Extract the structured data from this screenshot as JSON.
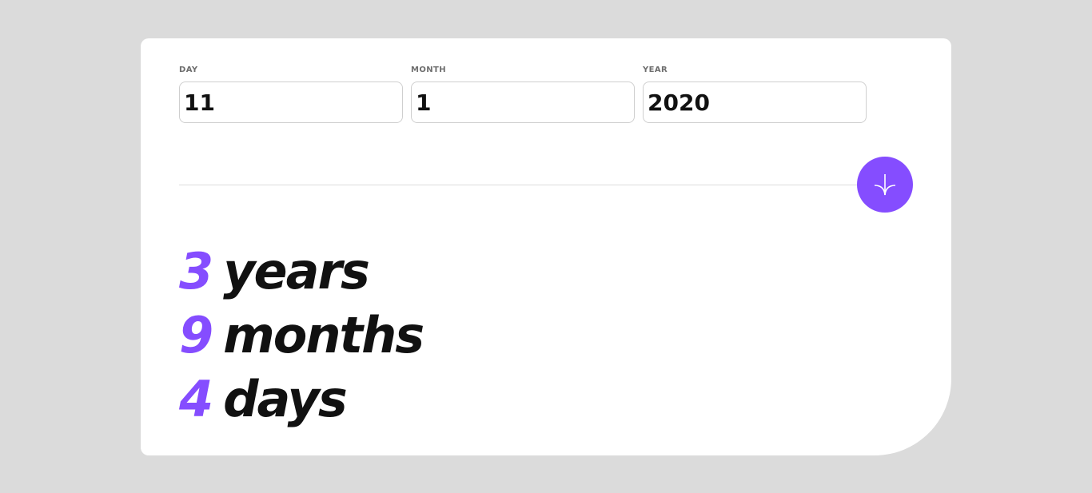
{
  "colors": {
    "accent": "#854dff",
    "background": "#dbdbdb",
    "card": "#ffffff",
    "text": "#111111",
    "label": "#6e6e6e"
  },
  "form": {
    "day": {
      "label": "DAY",
      "value": "11"
    },
    "month": {
      "label": "MONTH",
      "value": "1"
    },
    "year": {
      "label": "YEAR",
      "value": "2020"
    }
  },
  "submit": {
    "icon": "arrow-down-icon"
  },
  "results": {
    "years": {
      "value": "3",
      "unit": "years"
    },
    "months": {
      "value": "9",
      "unit": "months"
    },
    "days": {
      "value": "4",
      "unit": "days"
    }
  }
}
